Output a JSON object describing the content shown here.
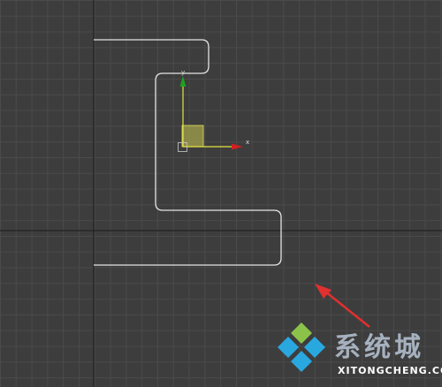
{
  "viewport": {
    "background": "#3d3d3d",
    "grid_color": "#4a4a4a",
    "axis_line_color": "#222222",
    "spline_color": "#e6e6e6"
  },
  "gizmo": {
    "x_label": "x",
    "y_label": "y",
    "x_color": "#d02020",
    "y_color": "#20a020",
    "plane_color": "#c8c850"
  },
  "annotation": {
    "arrow_color": "#e03030"
  },
  "watermark": {
    "title": "系统城",
    "subtitle": "XITONGCHENG.COM",
    "logo_colors": [
      "#8bc34a",
      "#29a8e0"
    ]
  }
}
